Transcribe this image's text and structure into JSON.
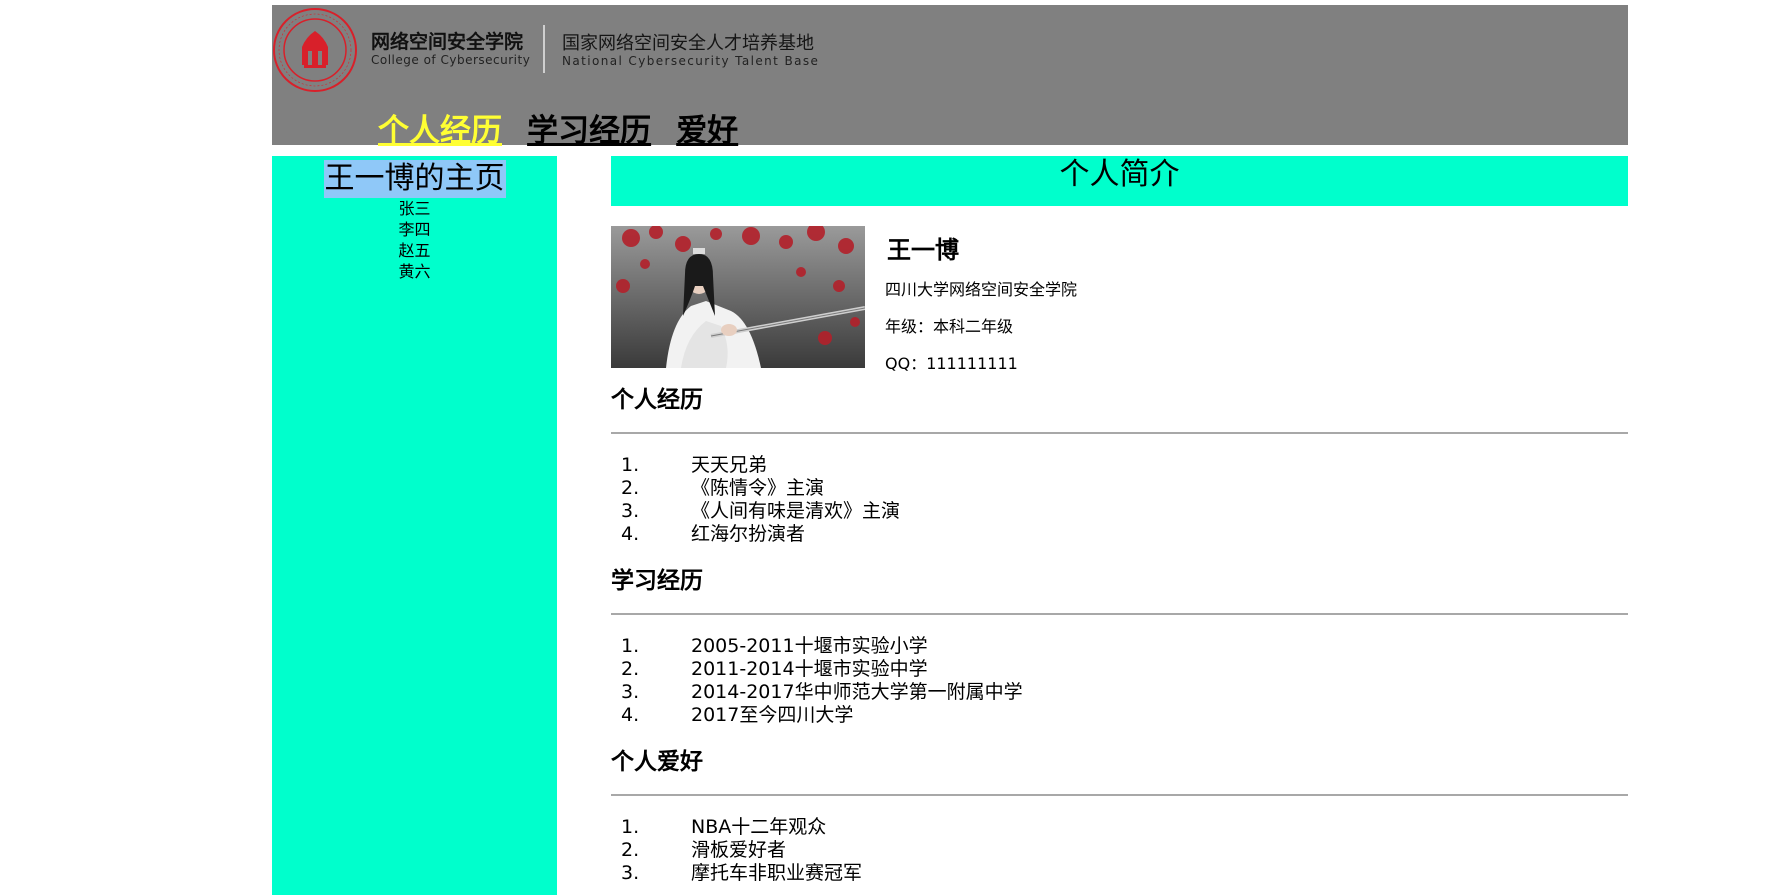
{
  "header": {
    "college_cn": "网络空间安全学院",
    "college_en": "College of Cybersecurity",
    "base_cn": "国家网络空间安全人才培养基地",
    "base_en": "National Cybersecurity Talent Base",
    "nav": [
      {
        "label": "个人经历",
        "active": true
      },
      {
        "label": "学习经历",
        "active": false
      },
      {
        "label": "爱好",
        "active": false
      }
    ]
  },
  "sidebar": {
    "title": "王一博的主页",
    "items": [
      "张三",
      "李四",
      "赵五",
      "黄六"
    ]
  },
  "main": {
    "banner": "个人简介",
    "profile": {
      "name": "王一博",
      "school": "四川大学网络空间安全学院",
      "grade": "年级：本科二年级",
      "qq": "QQ：111111111"
    },
    "sections": [
      {
        "title": "个人经历",
        "items": [
          {
            "num": "1.",
            "text": "天天兄弟"
          },
          {
            "num": "2.",
            "text": "《陈情令》主演"
          },
          {
            "num": "3.",
            "text": "《人间有味是清欢》主演"
          },
          {
            "num": "4.",
            "text": "红海尔扮演者"
          }
        ]
      },
      {
        "title": "学习经历",
        "items": [
          {
            "num": "1.",
            "text": "2005-2011十堰市实验小学"
          },
          {
            "num": "2.",
            "text": "2011-2014十堰市实验中学"
          },
          {
            "num": "3.",
            "text": "2014-2017华中师范大学第一附属中学"
          },
          {
            "num": "4.",
            "text": "2017至今四川大学"
          }
        ]
      },
      {
        "title": "个人爱好",
        "items": [
          {
            "num": "1.",
            "text": "NBA十二年观众"
          },
          {
            "num": "2.",
            "text": "滑板爱好者"
          },
          {
            "num": "3.",
            "text": "摩托车非职业赛冠军"
          }
        ]
      }
    ]
  },
  "colors": {
    "header_bg": "#808080",
    "accent_cyan": "#00ffcc",
    "nav_active": "#ffff33",
    "sidebar_title_bg": "#8fc8f8",
    "seal_red": "#d8202a"
  }
}
